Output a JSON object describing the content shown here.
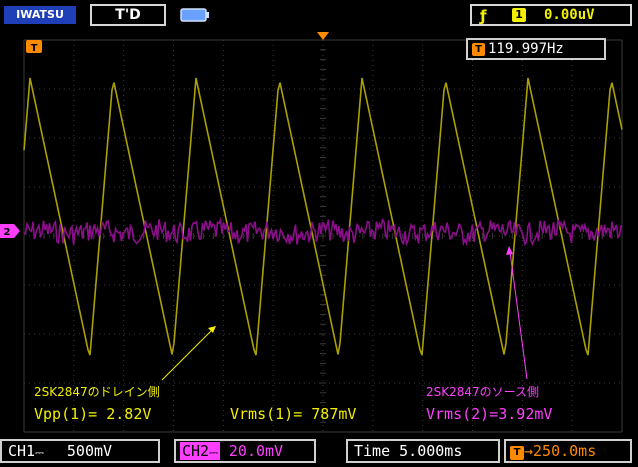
{
  "top_bar": {
    "brand": "IWATSU",
    "trigger_state": "T'D",
    "trigger_edge_icon": "rising-edge-icon",
    "trigger_source": "1",
    "trigger_level": "0.00uV"
  },
  "frequency": {
    "badge": "T",
    "value": "119.997Hz"
  },
  "markers": {
    "trigger_level_marker": "T",
    "ch2_ground_marker": "2"
  },
  "annotations": {
    "drain": "2SK2847のドレイン側",
    "source": "2SK2847のソース側"
  },
  "measurements": {
    "vpp1": "Vpp(1)= 2.82V",
    "vrms1": "Vrms(1)= 787mV",
    "vrms2": "Vrms(2)=3.92mV"
  },
  "bottom_bar": {
    "ch1_label": "CH1",
    "ch1_coupling": "⎓",
    "ch1_scale": "500mV",
    "ch2_label": "CH2",
    "ch2_coupling": "⎓",
    "ch2_scale": "20.0mV",
    "time_label": "Time",
    "time_scale": "5.000ms",
    "trigger_pos_badge": "T",
    "trigger_position": "→250.0ms"
  },
  "colors": {
    "ch1": "#f2f000",
    "ch1_trace": "#aaa000",
    "ch2": "#ff3fff",
    "ch2_trace": "#8b0f8b",
    "trigger": "#ff8a00",
    "grid": "#3a3a3a",
    "brand_bg": "#1e3fb8"
  }
}
